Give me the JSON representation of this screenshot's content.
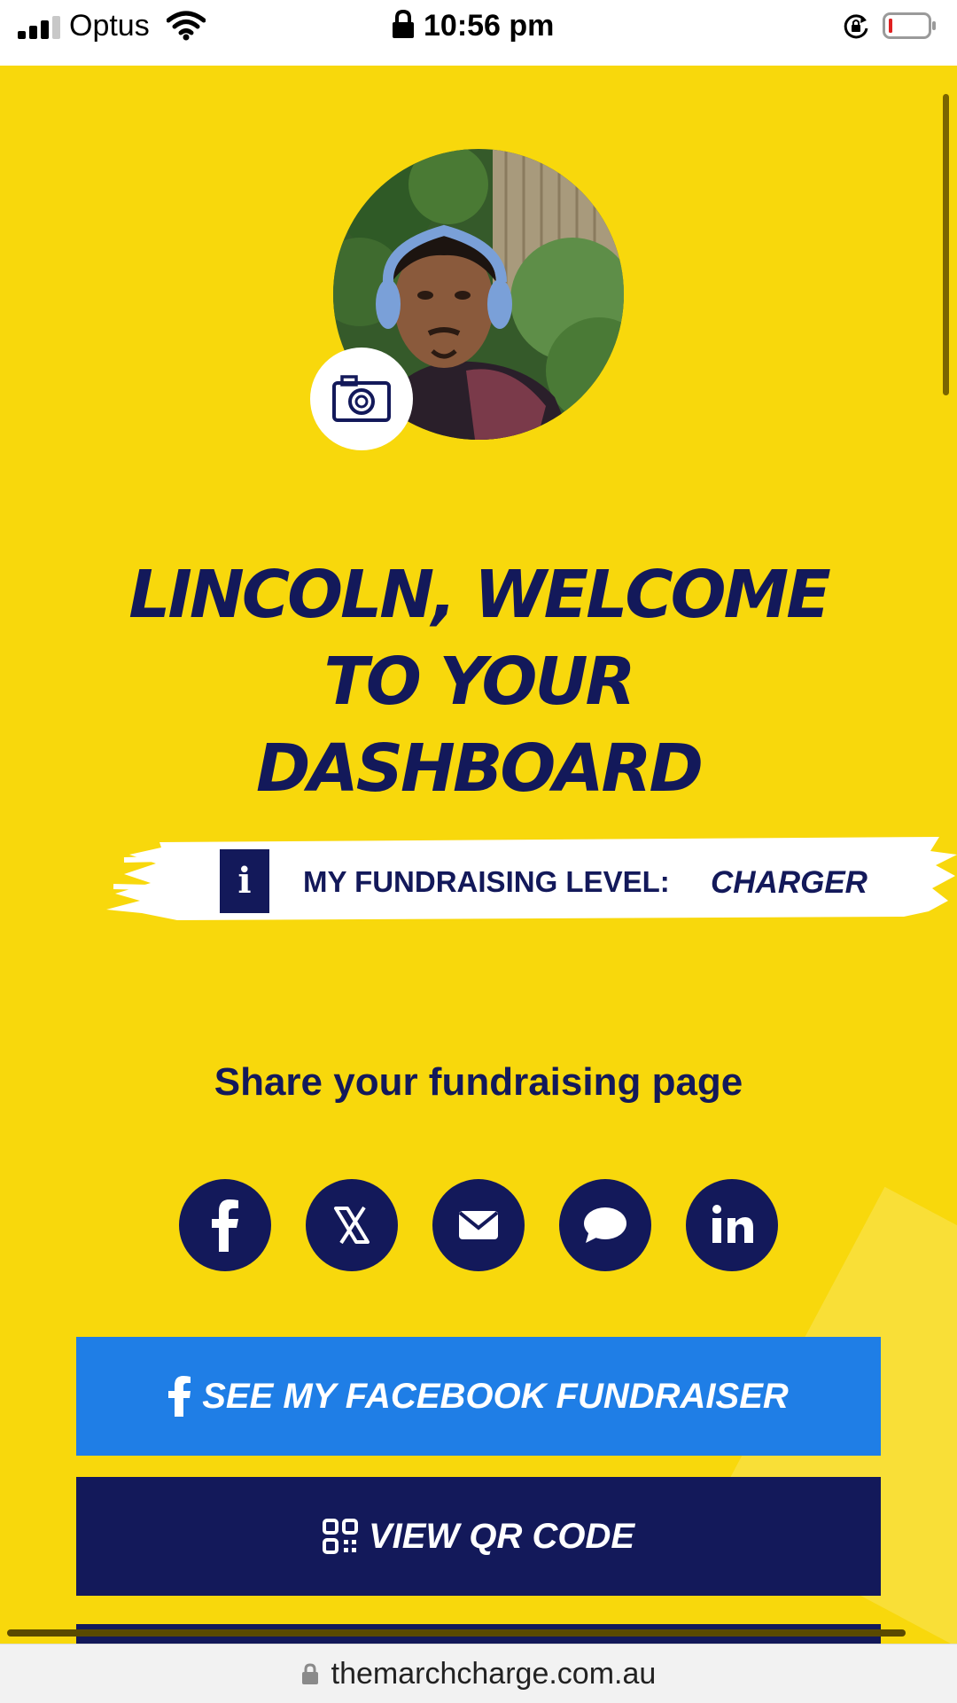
{
  "status_bar": {
    "carrier": "Optus",
    "time": "10:56 pm",
    "icons": [
      "signal-icon",
      "wifi-icon",
      "lock-icon",
      "rotation-lock-icon",
      "battery-icon"
    ]
  },
  "dashboard": {
    "title_lines": [
      "LINCOLN, WELCOME",
      "TO YOUR",
      "DASHBOARD"
    ],
    "fundraising_level_label": "MY FUNDRAISING LEVEL:",
    "fundraising_level_value": "CHARGER",
    "info_icon_glyph": "i"
  },
  "share": {
    "heading": "Share your fundraising page",
    "buttons": [
      {
        "icon": "facebook-icon"
      },
      {
        "icon": "x-icon"
      },
      {
        "icon": "email-icon"
      },
      {
        "icon": "message-icon"
      },
      {
        "icon": "linkedin-icon"
      }
    ]
  },
  "actions": {
    "facebook_fundraiser_label": "SEE MY FACEBOOK FUNDRAISER",
    "qr_code_label": "VIEW QR CODE"
  },
  "browser": {
    "url": "themarchcharge.com.au"
  },
  "colors": {
    "background": "#f8d80c",
    "navy": "#13195a",
    "facebook_blue": "#1f7ee6",
    "white": "#ffffff"
  }
}
